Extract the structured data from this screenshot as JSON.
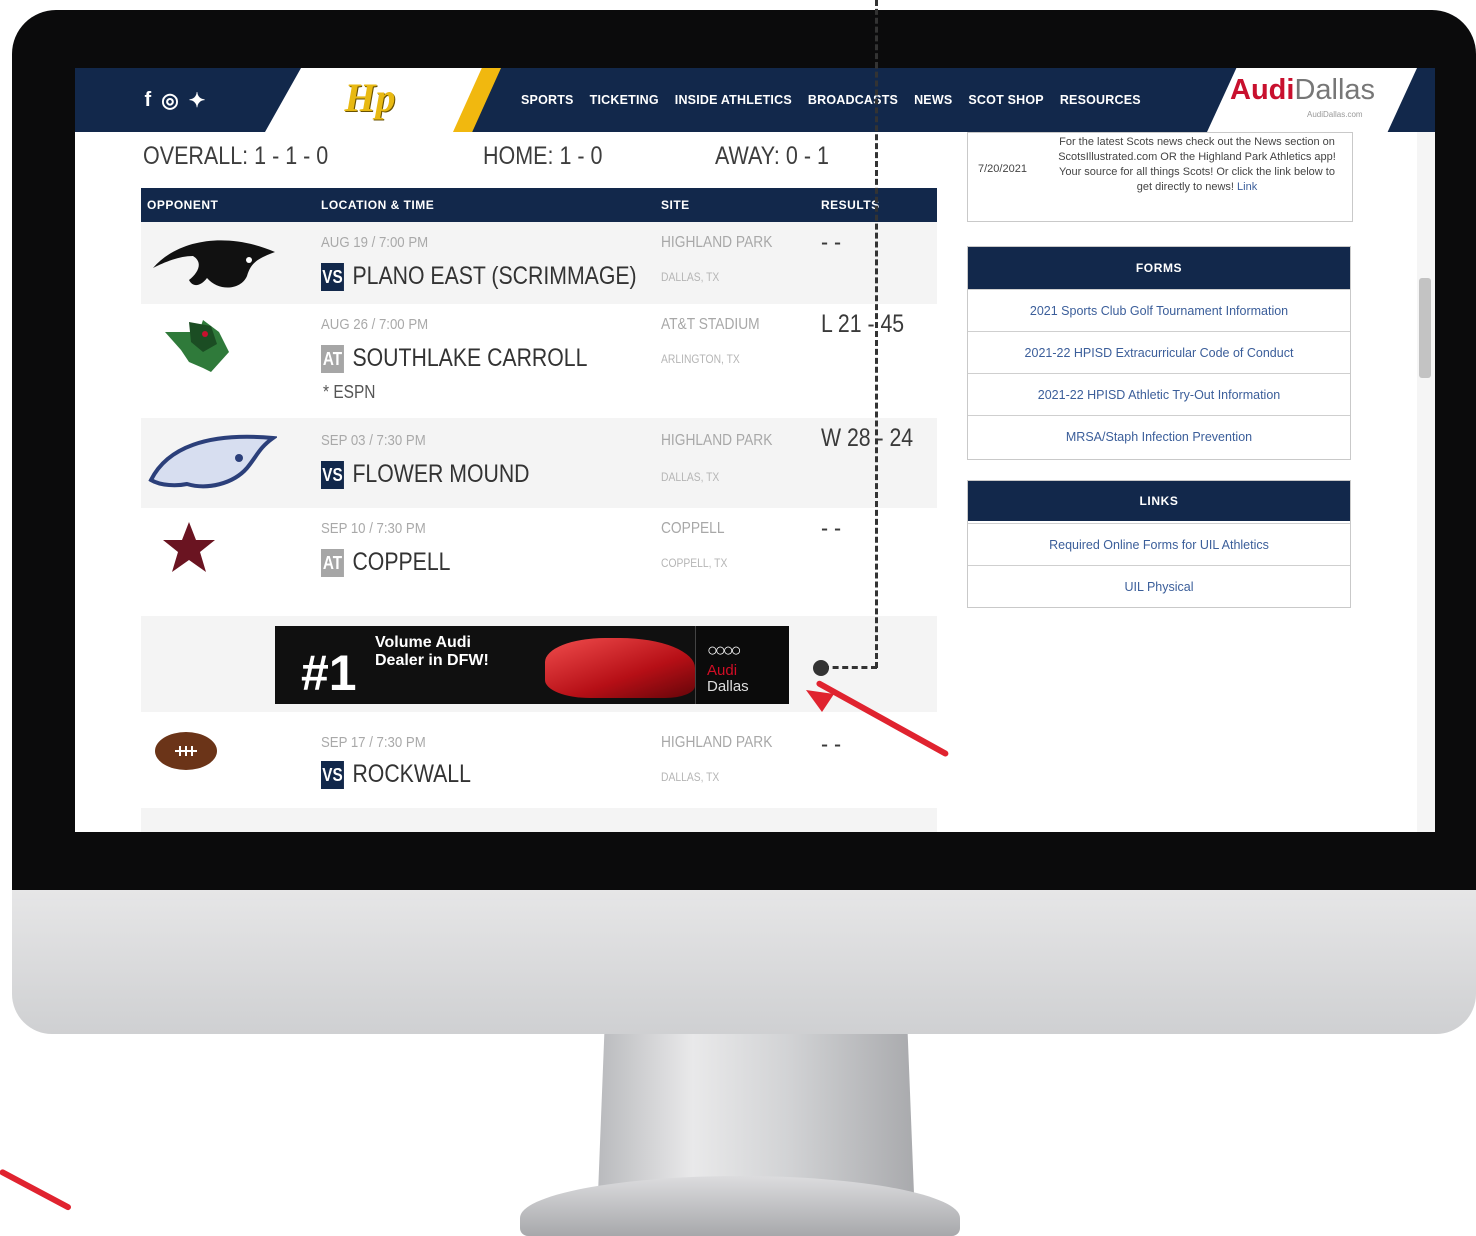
{
  "nav": {
    "social": [
      "f",
      "◎",
      "✦"
    ],
    "logo_text": "Hp",
    "menu": [
      "SPORTS",
      "TICKETING",
      "INSIDE ATHLETICS",
      "BROADCASTS",
      "NEWS",
      "SCOT SHOP",
      "RESOURCES"
    ],
    "sponsor_a": "Audi",
    "sponsor_b": "Dallas",
    "sponsor_sub": "AudiDallas.com"
  },
  "record": {
    "overall": "OVERALL: 1 - 1 - 0",
    "home": "HOME: 1 - 0",
    "away": "AWAY: 0 - 1"
  },
  "table": {
    "headers": [
      "OPPONENT",
      "LOCATION & TIME",
      "SITE",
      "RESULTS"
    ],
    "rows": [
      {
        "date": "AUG 19 / 7:00 PM",
        "tag": "VS",
        "opponent": "PLANO EAST (SCRIMMAGE)",
        "note": "",
        "site": "HIGHLAND PARK",
        "city": "DALLAS, TX",
        "result": "- -"
      },
      {
        "date": "AUG 26 / 7:00 PM",
        "tag": "AT",
        "opponent": "SOUTHLAKE CARROLL",
        "note": "* ESPN",
        "site": "AT&T STADIUM",
        "city": "ARLINGTON, TX",
        "result": "L 21 - 45"
      },
      {
        "date": "SEP 03 / 7:30 PM",
        "tag": "VS",
        "opponent": "FLOWER MOUND",
        "note": "",
        "site": "HIGHLAND PARK",
        "city": "DALLAS, TX",
        "result": "W 28 - 24"
      },
      {
        "date": "SEP 10 / 7:30 PM",
        "tag": "AT",
        "opponent": "COPPELL",
        "note": "",
        "site": "COPPELL",
        "city": "COPPELL, TX",
        "result": "- -"
      },
      {
        "date": "SEP 17 / 7:30 PM",
        "tag": "VS",
        "opponent": "ROCKWALL",
        "note": "",
        "site": "HIGHLAND PARK",
        "city": "DALLAS, TX",
        "result": "- -"
      }
    ]
  },
  "banner": {
    "number": "#1",
    "line1": "Volume Audi",
    "line2": "Dealer in DFW!",
    "rings": "○○○○",
    "brand": "Audi",
    "city": "Dallas"
  },
  "sidebar": {
    "news": {
      "date": "7/20/2021",
      "text": "For the latest Scots news check out the News section on ScotsIllustrated.com OR the Highland Park Athletics app! Your source for all things Scots! Or click the link below to get directly to news!",
      "link": "Link"
    },
    "forms": {
      "title": "FORMS",
      "items": [
        "2021 Sports Club Golf Tournament Information",
        "2021-22 HPISD Extracurricular Code of Conduct",
        "2021-22 HPISD Athletic Try-Out Information",
        "MRSA/Staph Infection Prevention"
      ]
    },
    "links": {
      "title": "LINKS",
      "items": [
        "Required Online Forms for UIL Athletics",
        "UIL Physical"
      ]
    }
  },
  "colors": {
    "navy": "#12284b",
    "gold": "#f1b80f",
    "audi_red": "#c8102e",
    "annotation_red": "#e0232f"
  }
}
